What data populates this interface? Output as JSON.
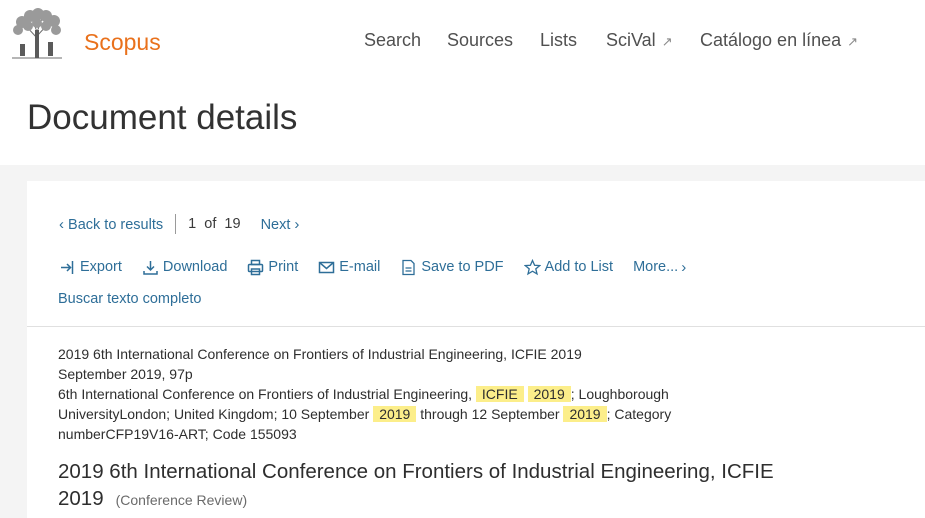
{
  "brand": {
    "name": "Scopus",
    "logo_icon": "elsevier-tree-icon"
  },
  "nav": {
    "items": [
      {
        "label": "Search",
        "external": false
      },
      {
        "label": "Sources",
        "external": false
      },
      {
        "label": "Lists",
        "external": false
      },
      {
        "label": "SciVal",
        "external": true
      },
      {
        "label": "Catálogo en línea",
        "external": true
      }
    ],
    "external_glyph": "↗"
  },
  "page_title": "Document details",
  "pager": {
    "back_label": "Back to results",
    "current": "1",
    "of_label": "of",
    "total": "19",
    "next_label": "Next"
  },
  "toolbar": {
    "export_label": "Export",
    "download_label": "Download",
    "print_label": "Print",
    "email_label": "E-mail",
    "save_pdf_label": "Save to PDF",
    "add_list_label": "Add to List",
    "more_label": "More..."
  },
  "fulltext_label": "Buscar texto completo",
  "source": {
    "line1": "2019 6th International Conference on Frontiers of Industrial Engineering, ICFIE 2019",
    "line2": "September 2019, 97p",
    "line3_a": "6th International Conference on Frontiers of Industrial Engineering, ",
    "hl_1": "ICFIE",
    "hl_2": "2019",
    "line3_b": "; Loughborough UniversityLondon; United Kingdom; 10 September ",
    "hl_3": "2019",
    "line3_c": " through 12 September ",
    "hl_4": "2019",
    "line3_d": "; Category numberCFP19V16-ART; Code 155093"
  },
  "document": {
    "title": "2019 6th International Conference on Frontiers of Industrial Engineering, ICFIE 2019",
    "type": "(Conference Review)"
  },
  "colors": {
    "brand_orange": "#e9711c",
    "link_blue": "#2e6e98",
    "highlight": "#fcee8a"
  }
}
